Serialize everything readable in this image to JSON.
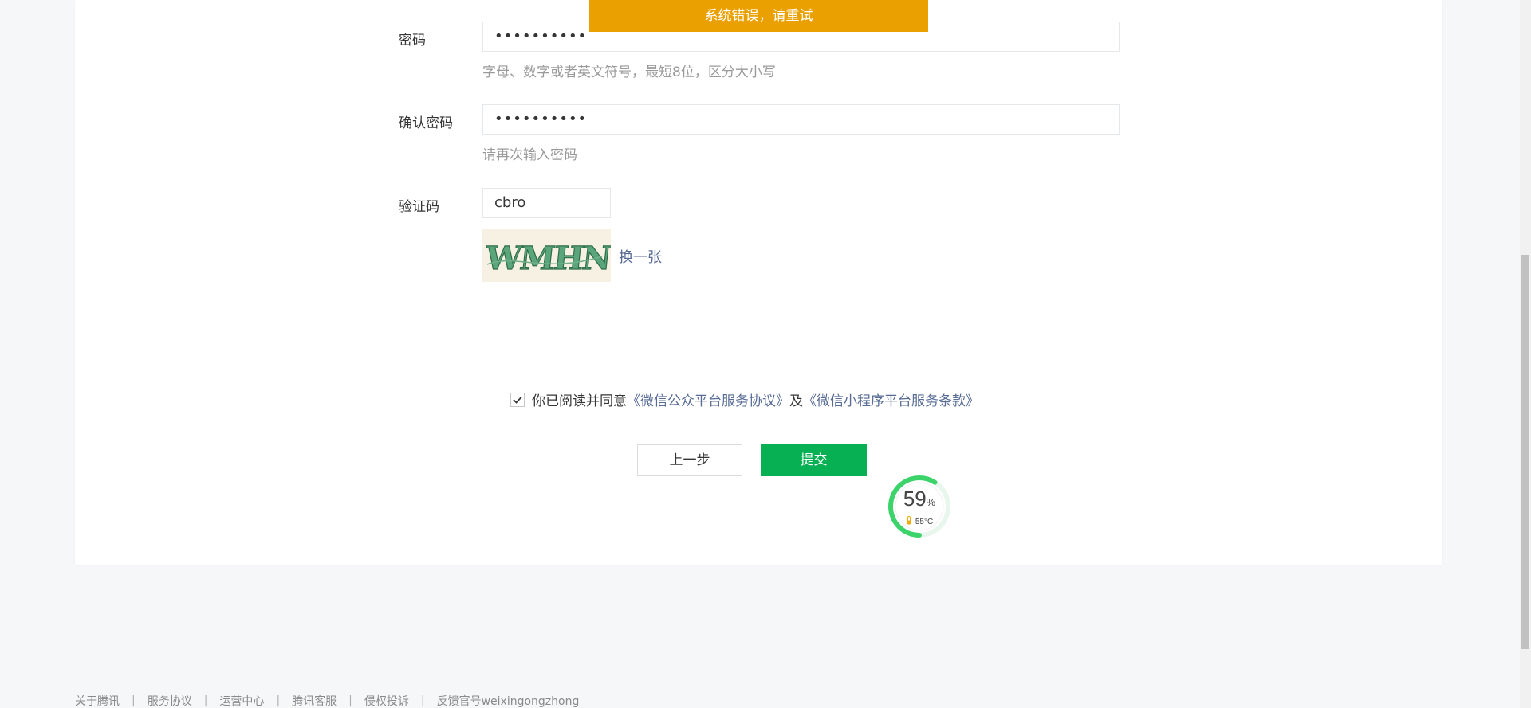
{
  "toast": {
    "message": "系统错误，请重试"
  },
  "form": {
    "password": {
      "label": "密码",
      "value": "••••••••••",
      "hint": "字母、数字或者英文符号，最短8位，区分大小写"
    },
    "confirm_password": {
      "label": "确认密码",
      "value": "••••••••••",
      "hint": "请再次输入密码"
    },
    "captcha": {
      "label": "验证码",
      "value": "cbro",
      "image_text": "WMHN",
      "refresh_label": "换一张"
    }
  },
  "agreement": {
    "checked": true,
    "prefix": "你已阅读并同意",
    "link1": "《微信公众平台服务协议》",
    "middle": "及",
    "link2": "《微信小程序平台服务条款》"
  },
  "buttons": {
    "prev_label": "上一步",
    "submit_label": "提交"
  },
  "widget": {
    "percent": "59",
    "percent_unit": "%",
    "temperature": "55°C",
    "percent_value": 0.59
  },
  "footer": {
    "links": [
      "关于腾讯",
      "服务协议",
      "运营中心",
      "腾讯客服",
      "侵权投诉",
      "反馈官号weixingongzhong"
    ],
    "separator": "|"
  },
  "colors": {
    "toast_bg": "#eaa000",
    "primary_green": "#07b053",
    "link_blue": "#576b95",
    "gauge_green": "#3dd36b"
  }
}
